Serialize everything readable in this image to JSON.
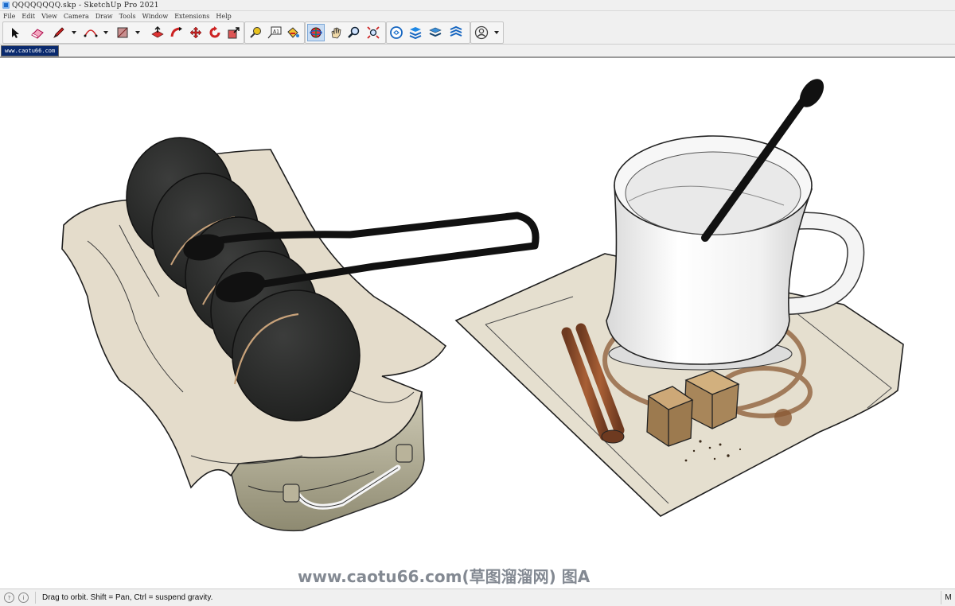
{
  "window": {
    "title": "QQQQQQQQ.skp - SketchUp Pro 2021"
  },
  "menu": {
    "items": [
      "File",
      "Edit",
      "View",
      "Camera",
      "Draw",
      "Tools",
      "Window",
      "Extensions",
      "Help"
    ]
  },
  "toolbar": {
    "tools": [
      "select-icon",
      "eraser-icon",
      "pencil-line-icon",
      "arc-icon",
      "rectangle-icon",
      "push-pull-icon",
      "follow-me-icon",
      "move-icon",
      "rotate-icon",
      "scale-icon",
      "tape-measure-icon",
      "text-icon",
      "paint-bucket-icon",
      "orbit-icon",
      "pan-icon",
      "zoom-icon",
      "zoom-extents-icon",
      "3d-warehouse-icon",
      "extension-warehouse-icon",
      "layout-icon",
      "sandbox-icon",
      "account-icon"
    ],
    "active_tool": "orbit-icon"
  },
  "scene": {
    "tab_label": "www.caotu66.com"
  },
  "viewport": {
    "watermark": "www.caotu66.com(草图溜溜网) 图A",
    "background": "#ffffff"
  },
  "status": {
    "message": "Drag to orbit. Shift = Pan, Ctrl = suspend gravity.",
    "measurement_label": "M"
  },
  "colors": {
    "chrome": "#f0f0f0",
    "scene_tab": "#0a2a6e",
    "cloth": "#e4dccb",
    "cookie": "#2f302f",
    "cup": "#f2f2f2",
    "cinnamon": "#8a4a2a",
    "sugar": "#a8865a",
    "stain": "#8b5a34"
  }
}
